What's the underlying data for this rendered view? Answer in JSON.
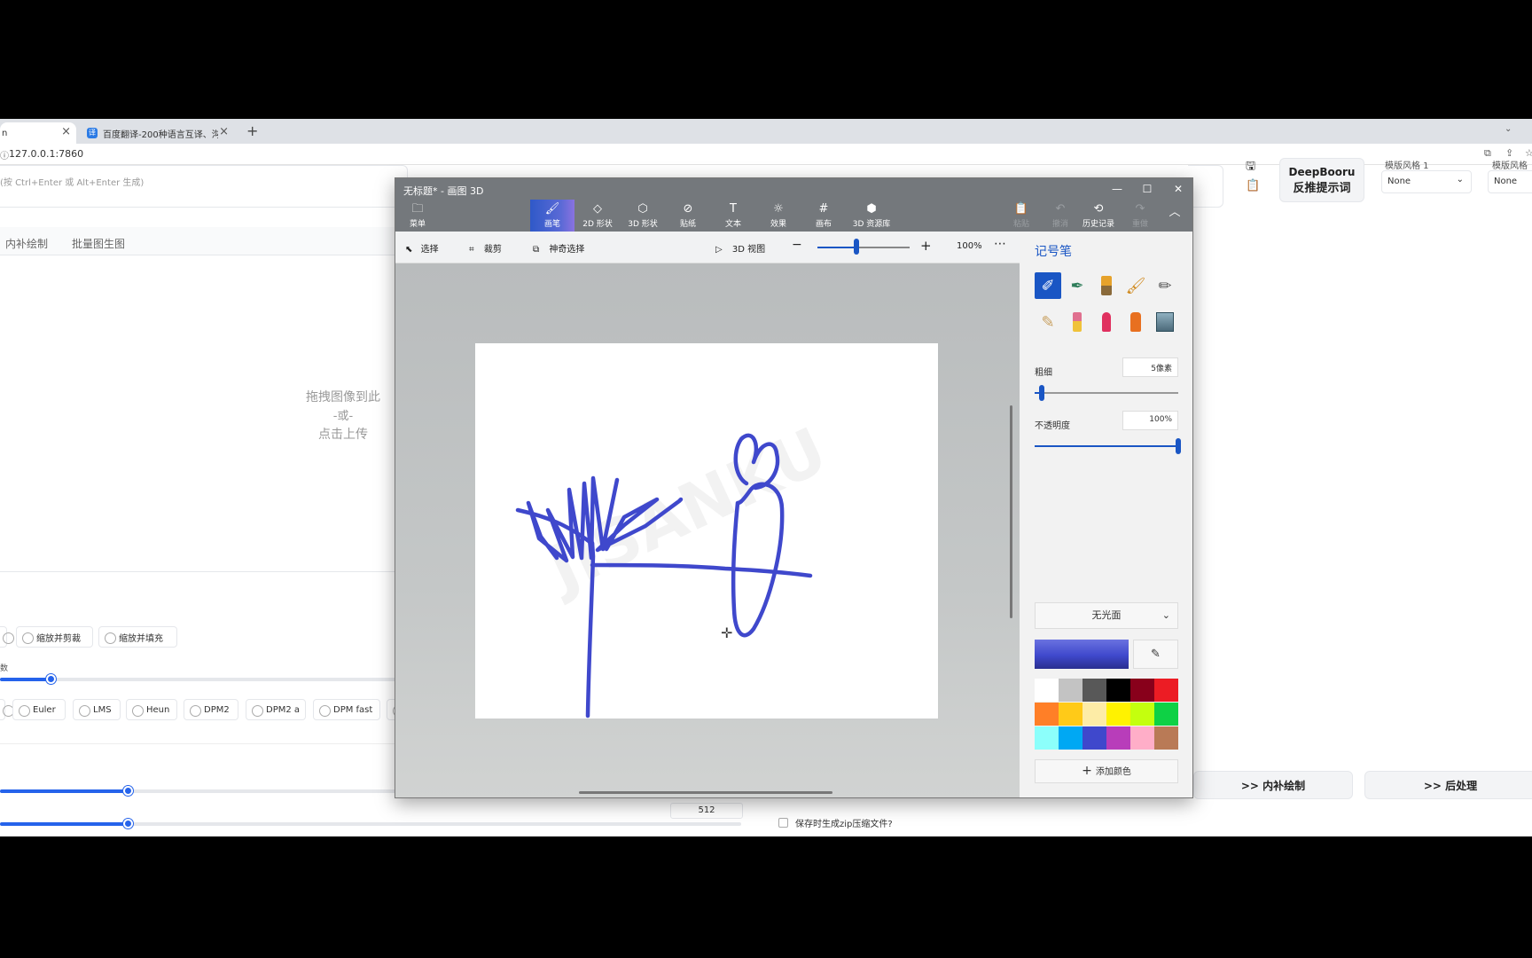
{
  "browser": {
    "tab_active_label": "n",
    "tab2_label": "百度翻译-200种语言互译、沟通",
    "url": "127.0.0.1:7860"
  },
  "webui": {
    "prompt_placeholder": "(按 Ctrl+Enter 或 Alt+Enter 生成)",
    "tabs": [
      "内补绘制",
      "批量图生图"
    ],
    "upload": {
      "line1": "拖拽图像到此",
      "line2": "-或-",
      "line3": "点击上传"
    },
    "resize_modes": [
      "缩放并剪裁",
      "缩放并填充"
    ],
    "steps_label": "数",
    "samplers": [
      "Euler",
      "LMS",
      "Heun",
      "DPM2",
      "DPM2 a",
      "DPM fast"
    ],
    "height_value": "512",
    "deepbooru_line1": "DeepBooru",
    "deepbooru_line2": "反推提示词",
    "style1_label": "模版风格 1",
    "style1_value": "None",
    "style2_label": "模版风格",
    "style2_value": "None",
    "to_inpaint": ">> 内补绘制",
    "to_extras": ">> 后处理",
    "zip_label": "保存时生成zip压缩文件?"
  },
  "paint3d": {
    "title": "无标题* - 画图 3D",
    "menu_label": "菜单",
    "ribbon": [
      {
        "label": "画笔",
        "icon": "brush-icon",
        "selected": true
      },
      {
        "label": "2D 形状",
        "icon": "2d-shapes-icon"
      },
      {
        "label": "3D 形状",
        "icon": "3d-shapes-icon"
      },
      {
        "label": "贴纸",
        "icon": "sticker-icon"
      },
      {
        "label": "文本",
        "icon": "text-icon"
      },
      {
        "label": "效果",
        "icon": "effects-icon"
      },
      {
        "label": "画布",
        "icon": "canvas-icon"
      },
      {
        "label": "3D 资源库",
        "icon": "3d-library-icon"
      }
    ],
    "right_ribbon": [
      {
        "label": "粘贴",
        "disabled": true
      },
      {
        "label": "撤消",
        "disabled": true
      },
      {
        "label": "历史记录",
        "disabled": false
      },
      {
        "label": "重做",
        "disabled": true
      }
    ],
    "toolbar": {
      "select": "选择",
      "crop": "裁剪",
      "magic_select": "神奇选择",
      "view3d": "3D 视图",
      "zoom": "100%",
      "zoom_fraction": 0.42
    },
    "panel": {
      "title": "记号笔",
      "thickness_label": "粗细",
      "thickness_value": "5像素",
      "thickness_fraction": 0.05,
      "opacity_label": "不透明度",
      "opacity_value": "100%",
      "opacity_fraction": 1.0,
      "finish": "无光面",
      "current_color": "#3f48cc",
      "add_color": "添加颜色",
      "palette": [
        "#ffffff",
        "#c3c3c3",
        "#585858",
        "#000000",
        "#88001b",
        "#ec1c24",
        "#ff7f27",
        "#ffca18",
        "#fdeca6",
        "#fff200",
        "#c4ff0e",
        "#0ed145",
        "#8cfffb",
        "#00a8f3",
        "#3f48cc",
        "#b83dba",
        "#ffaec8",
        "#b97a56"
      ]
    },
    "watermark": "JISANKU"
  }
}
